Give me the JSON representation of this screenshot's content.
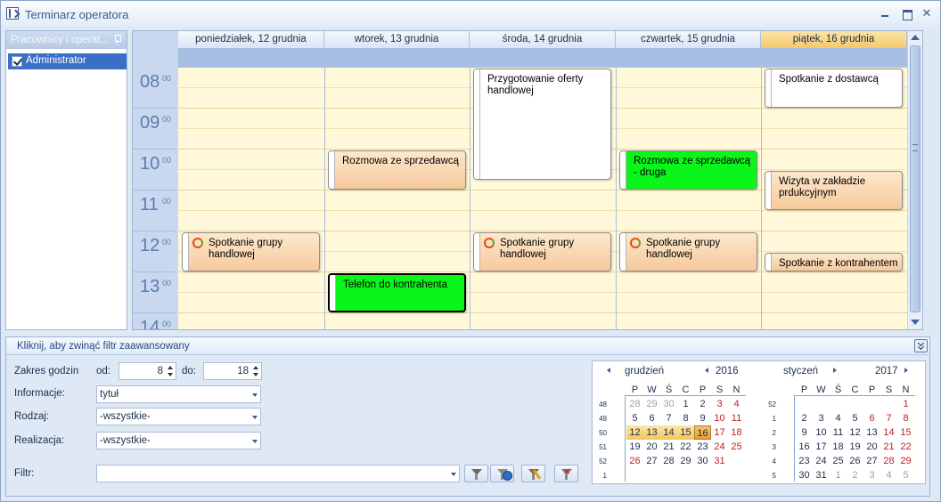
{
  "window": {
    "title": "Terminarz operatora"
  },
  "left_panel": {
    "header": "Pracownicy i operat...",
    "items": [
      {
        "label": "Administrator",
        "checked": true
      }
    ]
  },
  "scheduler": {
    "days": [
      {
        "label": "poniedziałek, 12 grudnia",
        "today": false
      },
      {
        "label": "wtorek, 13 grudnia",
        "today": false
      },
      {
        "label": "środa, 14 grudnia",
        "today": false
      },
      {
        "label": "czwartek, 15 grudnia",
        "today": false
      },
      {
        "label": "piątek, 16 grudnia",
        "today": true
      }
    ],
    "hours": [
      {
        "h": "08",
        "m": "00"
      },
      {
        "h": "09",
        "m": "00"
      },
      {
        "h": "10",
        "m": "00"
      },
      {
        "h": "11",
        "m": "00"
      },
      {
        "h": "12",
        "m": "00"
      },
      {
        "h": "13",
        "m": "00"
      },
      {
        "h": "14",
        "m": "00"
      }
    ],
    "appointments": [
      {
        "day": 2,
        "start": "08:00",
        "end": "10:45",
        "subject": "Przygotowanie oferty handlowej",
        "style": "white",
        "recurring": false
      },
      {
        "day": 4,
        "start": "08:00",
        "end": "09:00",
        "subject": "Spotkanie z dostawcą",
        "style": "white",
        "recurring": false
      },
      {
        "day": 1,
        "start": "10:00",
        "end": "11:00",
        "subject": "Rozmowa ze sprzedawcą",
        "style": "orange",
        "recurring": false
      },
      {
        "day": 3,
        "start": "10:00",
        "end": "11:00",
        "subject": "Rozmowa ze sprzedawcą - druga",
        "style": "green",
        "recurring": false
      },
      {
        "day": 4,
        "start": "10:30",
        "end": "11:30",
        "subject": "Wizyta w zakładzie prdukcyjnym",
        "style": "orange",
        "recurring": false
      },
      {
        "day": 0,
        "start": "12:00",
        "end": "13:00",
        "subject": "Spotkanie grupy handlowej",
        "style": "orange",
        "recurring": true
      },
      {
        "day": 2,
        "start": "12:00",
        "end": "13:00",
        "subject": "Spotkanie grupy handlowej",
        "style": "orange",
        "recurring": true
      },
      {
        "day": 3,
        "start": "12:00",
        "end": "13:00",
        "subject": "Spotkanie grupy handlowej",
        "style": "orange",
        "recurring": true
      },
      {
        "day": 4,
        "start": "12:30",
        "end": "13:00",
        "subject": "Spotkanie z kontrahentem",
        "style": "orange",
        "recurring": false
      },
      {
        "day": 1,
        "start": "13:00",
        "end": "14:00",
        "subject": "Telefon do kontrahenta",
        "style": "green",
        "recurring": false,
        "bold": true
      }
    ]
  },
  "filter": {
    "header": "Kliknij, aby zwinąć filtr zaawansowany",
    "hours_label": "Zakres godzin",
    "from_label": "od:",
    "from_value": "8",
    "to_label": "do:",
    "to_value": "18",
    "info_label": "Informacje:",
    "info_value": "tytuł",
    "kind_label": "Rodzaj:",
    "kind_value": "-wszystkie-",
    "realization_label": "Realizacja:",
    "realization_value": "-wszystkie-",
    "filter_label": "Filtr:",
    "filter_value": ""
  },
  "calendars": [
    {
      "month": "grudzień",
      "year": "2016",
      "dow": [
        "P",
        "W",
        "Ś",
        "C",
        "P",
        "S",
        "N"
      ],
      "weeks": [
        {
          "wk": "48",
          "days": [
            {
              "d": "28",
              "o": true
            },
            {
              "d": "29",
              "o": true
            },
            {
              "d": "30",
              "o": true
            },
            {
              "d": "1"
            },
            {
              "d": "2"
            },
            {
              "d": "3",
              "w": true
            },
            {
              "d": "4",
              "w": true
            }
          ]
        },
        {
          "wk": "49",
          "days": [
            {
              "d": "5"
            },
            {
              "d": "6"
            },
            {
              "d": "7"
            },
            {
              "d": "8"
            },
            {
              "d": "9"
            },
            {
              "d": "10",
              "w": true
            },
            {
              "d": "11",
              "w": true
            }
          ]
        },
        {
          "wk": "50",
          "days": [
            {
              "d": "12",
              "s": true
            },
            {
              "d": "13",
              "s": true
            },
            {
              "d": "14",
              "s": true
            },
            {
              "d": "15",
              "s": true
            },
            {
              "d": "16",
              "t": true
            },
            {
              "d": "17",
              "w": true
            },
            {
              "d": "18",
              "w": true
            }
          ]
        },
        {
          "wk": "51",
          "days": [
            {
              "d": "19"
            },
            {
              "d": "20"
            },
            {
              "d": "21"
            },
            {
              "d": "22"
            },
            {
              "d": "23"
            },
            {
              "d": "24",
              "w": true
            },
            {
              "d": "25",
              "w": true
            }
          ]
        },
        {
          "wk": "52",
          "days": [
            {
              "d": "26",
              "w": true
            },
            {
              "d": "27"
            },
            {
              "d": "28"
            },
            {
              "d": "29"
            },
            {
              "d": "30"
            },
            {
              "d": "31",
              "w": true
            }
          ]
        },
        {
          "wk": "1",
          "days": []
        }
      ]
    },
    {
      "month": "styczeń",
      "year": "2017",
      "dow": [
        "P",
        "W",
        "Ś",
        "C",
        "P",
        "S",
        "N"
      ],
      "weeks": [
        {
          "wk": "52",
          "days": [
            {
              "d": "",
              "e": true
            },
            {
              "d": "",
              "e": true
            },
            {
              "d": "",
              "e": true
            },
            {
              "d": "",
              "e": true
            },
            {
              "d": "",
              "e": true
            },
            {
              "d": "",
              "e": true
            },
            {
              "d": "1",
              "w": true
            }
          ]
        },
        {
          "wk": "1",
          "days": [
            {
              "d": "2"
            },
            {
              "d": "3"
            },
            {
              "d": "4"
            },
            {
              "d": "5"
            },
            {
              "d": "6",
              "w": true
            },
            {
              "d": "7",
              "w": true
            },
            {
              "d": "8",
              "w": true
            }
          ]
        },
        {
          "wk": "2",
          "days": [
            {
              "d": "9"
            },
            {
              "d": "10"
            },
            {
              "d": "11"
            },
            {
              "d": "12"
            },
            {
              "d": "13"
            },
            {
              "d": "14",
              "w": true
            },
            {
              "d": "15",
              "w": true
            }
          ]
        },
        {
          "wk": "3",
          "days": [
            {
              "d": "16"
            },
            {
              "d": "17"
            },
            {
              "d": "18"
            },
            {
              "d": "19"
            },
            {
              "d": "20"
            },
            {
              "d": "21",
              "w": true
            },
            {
              "d": "22",
              "w": true
            }
          ]
        },
        {
          "wk": "4",
          "days": [
            {
              "d": "23"
            },
            {
              "d": "24"
            },
            {
              "d": "25"
            },
            {
              "d": "26"
            },
            {
              "d": "27"
            },
            {
              "d": "28",
              "w": true
            },
            {
              "d": "29",
              "w": true
            }
          ]
        },
        {
          "wk": "5",
          "days": [
            {
              "d": "30"
            },
            {
              "d": "31"
            },
            {
              "d": "1",
              "o": true
            },
            {
              "d": "2",
              "o": true
            },
            {
              "d": "3",
              "o": true
            },
            {
              "d": "4",
              "o": true
            },
            {
              "d": "5",
              "o": true
            }
          ]
        }
      ]
    }
  ],
  "colors": {
    "accent": "#3b6fc7",
    "today_header": "#f6c96a",
    "appointment_orange": "#f6c99c",
    "appointment_green": "#0af51a",
    "weekend_text": "#c02020"
  }
}
